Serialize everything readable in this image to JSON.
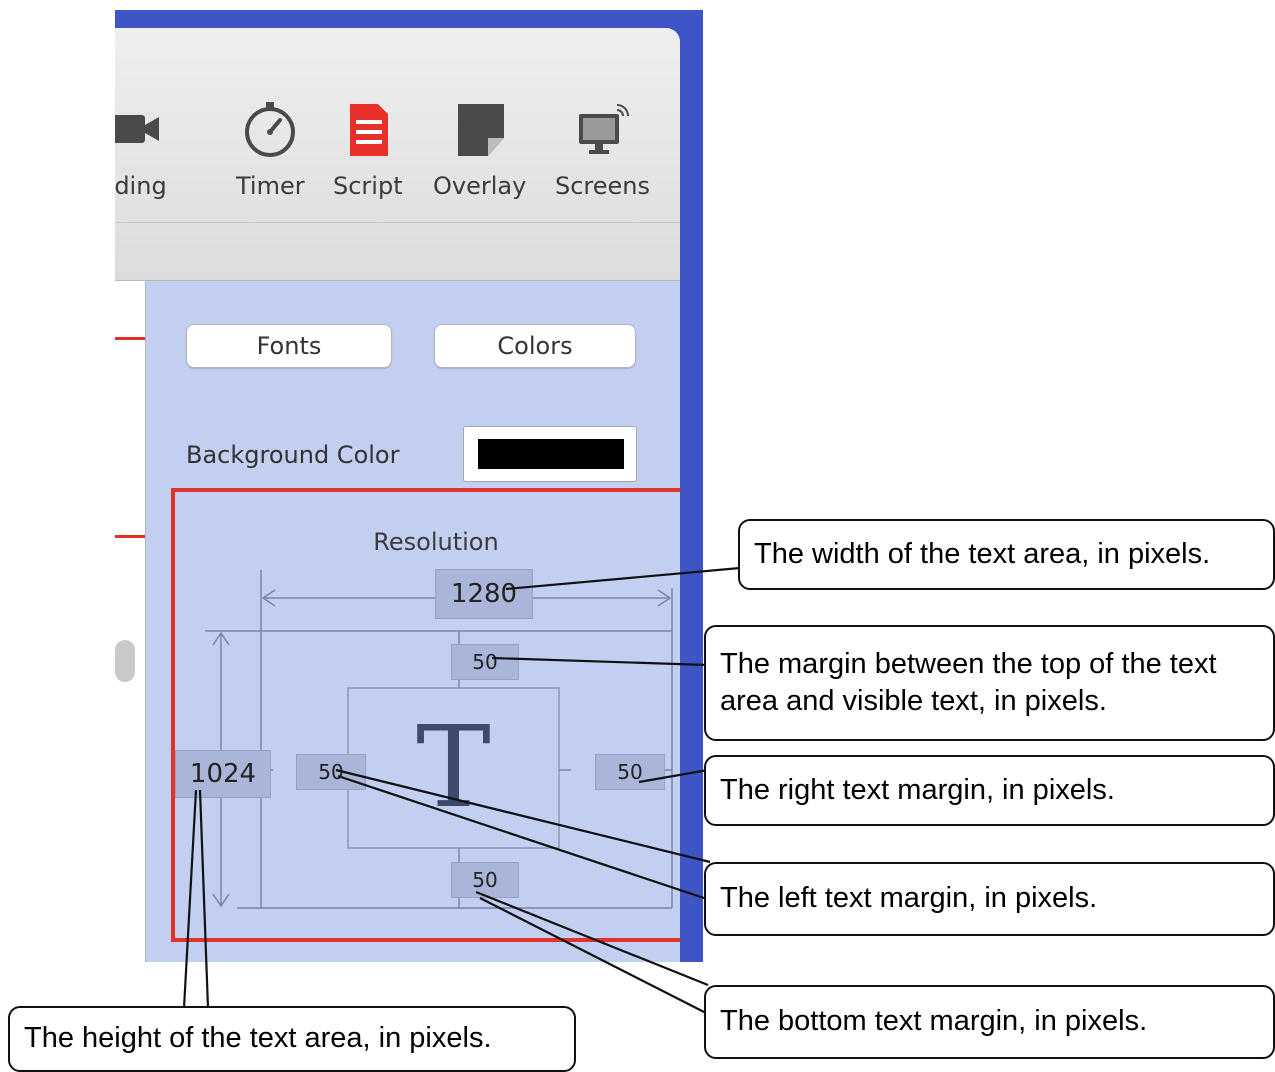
{
  "toolbar": {
    "items": [
      {
        "label": "cording",
        "icon": "video-camera-icon"
      },
      {
        "label": "Timer",
        "icon": "timer-icon"
      },
      {
        "label": "Script",
        "icon": "script-document-icon"
      },
      {
        "label": "Overlay",
        "icon": "overlay-icon"
      },
      {
        "label": "Screens",
        "icon": "screens-monitor-icon"
      }
    ]
  },
  "panel": {
    "fonts_button": "Fonts",
    "colors_button": "Colors",
    "background_color_label": "Background Color",
    "background_color_value": "#000000",
    "resolution": {
      "title": "Resolution",
      "width": "1280",
      "height": "1024",
      "margin_top": "50",
      "margin_left": "50",
      "margin_right": "50",
      "margin_bottom": "50",
      "preview_glyph": "T"
    }
  },
  "colors": {
    "accent_red": "#e5302a",
    "panel_blue": "#c3cff0",
    "desktop_blue": "#3e55c6"
  },
  "callouts": {
    "width": "The width of the text area, in pixels.",
    "top_margin": "The margin between the top of the text area and visible text, in pixels.",
    "right_margin": "The right text margin, in pixels.",
    "left_margin": "The left text margin, in pixels.",
    "bottom_margin": "The bottom text margin, in pixels.",
    "height": "The height of the text area, in pixels."
  }
}
